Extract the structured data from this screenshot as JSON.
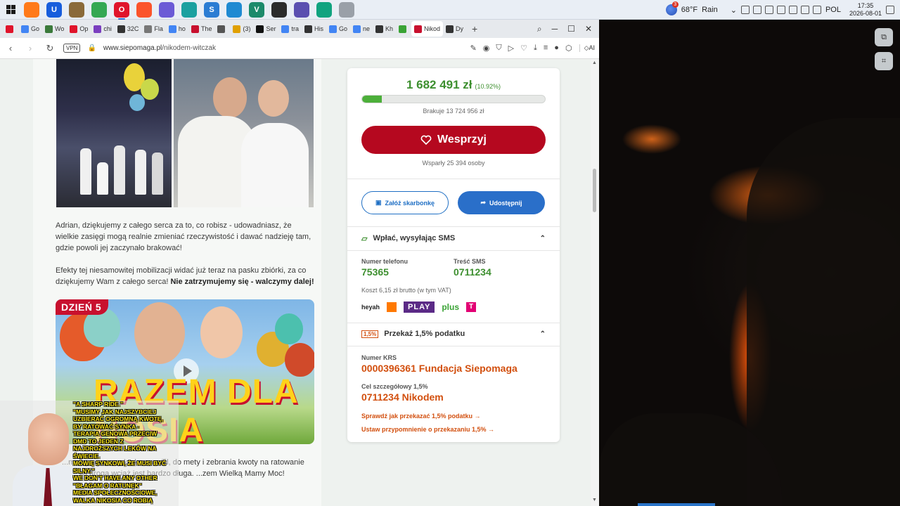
{
  "taskbar": {
    "apps": [
      {
        "name": "firefox",
        "color": "#ff7a1a",
        "glyph": ""
      },
      {
        "name": "bitwarden",
        "color": "#175ddc",
        "glyph": "U"
      },
      {
        "name": "library",
        "color": "#8a6a3a",
        "glyph": ""
      },
      {
        "name": "chrome",
        "color": "#34a853",
        "glyph": ""
      },
      {
        "name": "opera",
        "color": "#e0142b",
        "glyph": "O"
      },
      {
        "name": "brave",
        "color": "#fb542b",
        "glyph": ""
      },
      {
        "name": "copilot",
        "color": "#6b5bd6",
        "glyph": ""
      },
      {
        "name": "notepad",
        "color": "#1aa0a0",
        "glyph": ""
      },
      {
        "name": "s-app",
        "color": "#2b7cd3",
        "glyph": "S"
      },
      {
        "name": "vscode",
        "color": "#1f8ad2",
        "glyph": ""
      },
      {
        "name": "v-app",
        "color": "#1c8a6b",
        "glyph": "V"
      },
      {
        "name": "obs",
        "color": "#2b2b2b",
        "glyph": ""
      },
      {
        "name": "settings",
        "color": "#5a4fb0",
        "glyph": ""
      },
      {
        "name": "chatgpt",
        "color": "#10a37f",
        "glyph": ""
      },
      {
        "name": "photos",
        "color": "#9aa0a8",
        "glyph": ""
      }
    ],
    "weather": {
      "temp": "68°F",
      "condition": "Rain"
    },
    "language": "POL",
    "time": "17:35",
    "date": "2026-08-01"
  },
  "browser": {
    "tabs": [
      {
        "label": "",
        "color": "#e0142b"
      },
      {
        "label": "Go",
        "color": "#4285f4"
      },
      {
        "label": "Wo",
        "color": "#3b7a3b"
      },
      {
        "label": "Op",
        "color": "#e0142b"
      },
      {
        "label": "chi",
        "color": "#7b3fbf"
      },
      {
        "label": "32C",
        "color": "#333333"
      },
      {
        "label": "Fla",
        "color": "#777777"
      },
      {
        "label": "ho",
        "color": "#4285f4"
      },
      {
        "label": "The",
        "color": "#c8102e"
      },
      {
        "label": "",
        "color": "#555555"
      },
      {
        "label": "(3)",
        "color": "#e0a000"
      },
      {
        "label": "Ser",
        "color": "#111111"
      },
      {
        "label": "tra",
        "color": "#4285f4"
      },
      {
        "label": "His",
        "color": "#333333"
      },
      {
        "label": "Go",
        "color": "#4285f4"
      },
      {
        "label": "ne",
        "color": "#4285f4"
      },
      {
        "label": "Kh",
        "color": "#333333"
      },
      {
        "label": "",
        "color": "#3aa335"
      },
      {
        "label": "Nikod",
        "color": "#c8102e",
        "active": true
      },
      {
        "label": "Dy",
        "color": "#333333"
      }
    ],
    "new_tab": "+",
    "address": {
      "vpn": "VPN",
      "url_host": "www.siepomaga.pl",
      "url_path": "/nikodem-witczak"
    },
    "ai_label": "AI"
  },
  "article": {
    "para1": "Adrian, dziękujemy z całego serca za to, co robisz - udowadniasz, że wielkie zasięgi mogą realnie zmieniać rzeczywistość i dawać nadzieję tam, gdzie powoli jej zaczynało brakować!",
    "para2_start": "Efekty tej niesamowitej mobilizacji widać już teraz na pasku zbiórki, za co dziękujemy Wam z całego serca! ",
    "para2_bold": "Nie zatrzymujemy się - walczymy dalej!",
    "promo_badge": "DZIEŃ 5",
    "promo_title": "RAZEM DLA NOSIA",
    "para3": "...mamy ogromny krok naprzód, do mety i zebrania kwoty na ratowanie Nikosia droga wciąż jest bardzo długa. ...zem Wielką Mamy Moc!"
  },
  "donation": {
    "amount": "1 682 491 zł",
    "percent_label": "(10.92%)",
    "progress_fraction": 0.1092,
    "missing": "Brakuje 13 724 956 zł",
    "donate_label": "Wesprzyj",
    "supporters": "Wsparły 25 394 osoby",
    "piggybank_label": "Załóż skarbonkę",
    "share_label": "Udostępnij",
    "sms": {
      "title": "Wpłać, wysyłając SMS",
      "phone_label": "Numer telefonu",
      "phone_value": "75365",
      "text_label": "Treść SMS",
      "text_value": "0711234",
      "cost": "Koszt 6,15 zł brutto (w tym VAT)",
      "operators": [
        "heyah",
        "orange",
        "PLAY",
        "plus",
        "T"
      ]
    },
    "tax": {
      "badge": "1,5%",
      "title": "Przekaż 1,5% podatku",
      "krs_label": "Numer KRS",
      "krs_value": "0000396361 Fundacja Siepomaga",
      "goal_label": "Cel szczegółowy 1,5%",
      "goal_value": "0711234 Nikodem",
      "link1": "Sprawdź jak przekazać 1,5% podatku →",
      "link2": "Ustaw przypomnienie o przekazaniu 1,5% →"
    }
  },
  "subtitles": [
    "\"A SHARP RIDE.\"",
    "\"MUSIMY JAK NAJSZYBCIEJ",
    "UZBIERAĆ OGROMNĄ KWOTĘ,",
    "BY RATOWAĆ SYNKA -",
    "TERAPIA GENOWA PRZECIW",
    "DMD TO JEDEN Z",
    "NAJDROŻSZYCH LEKÓW NA",
    "ŚWIECIE.",
    "MÓWIĘ SYNKOWI, ŻE MUSI BYĆ",
    "SILNY.\"",
    "WE DON'T HAVE ANY OTHER",
    "\"BŁAGAM O RATUNEK\"",
    "MEDIA SPOŁECZNOŚCIOWE,",
    "WALKA NIKOSIA CO ROBIĄ"
  ]
}
